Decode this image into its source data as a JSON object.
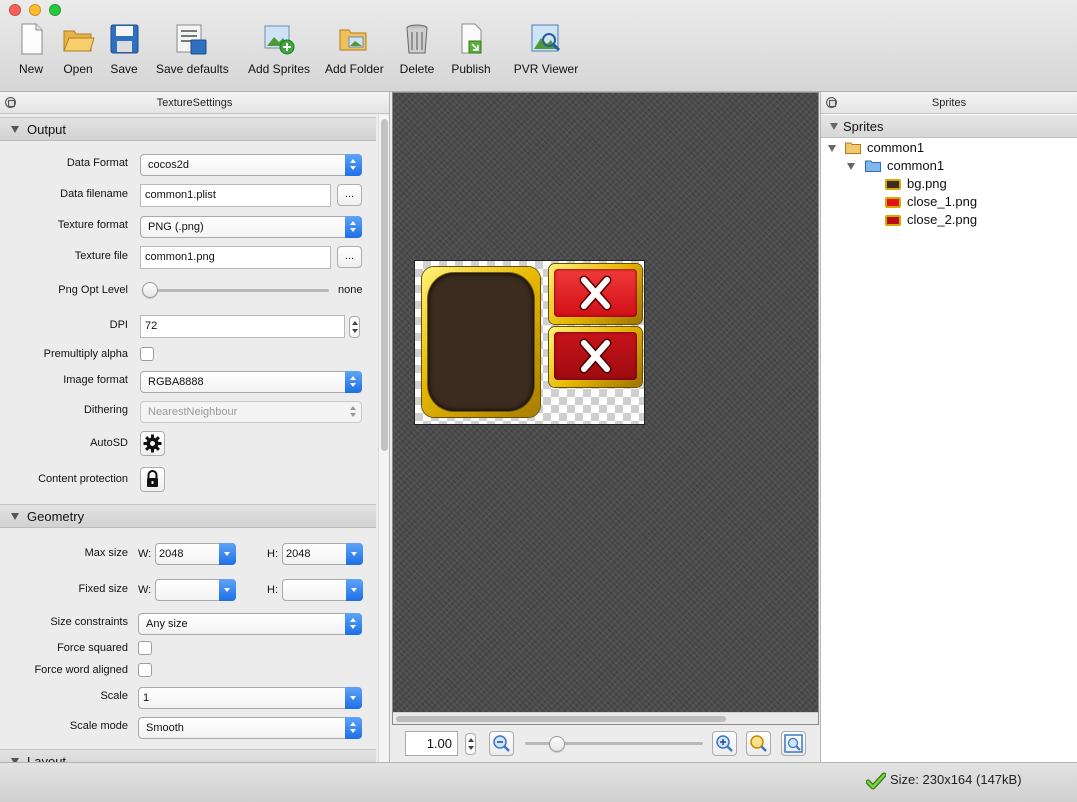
{
  "window": {
    "traffic_lights": [
      {
        "name": "close",
        "color": "#fc5f57"
      },
      {
        "name": "minimize",
        "color": "#fdbc2e"
      },
      {
        "name": "zoom",
        "color": "#28c840"
      }
    ]
  },
  "toolbar": {
    "buttons": [
      {
        "label": "New",
        "icon": "new-document-icon"
      },
      {
        "label": "Open",
        "icon": "open-folder-icon"
      },
      {
        "label": "Save",
        "icon": "save-floppy-icon"
      },
      {
        "label": "Save defaults",
        "icon": "save-defaults-icon"
      },
      {
        "label": "Add Sprites",
        "icon": "add-sprites-icon"
      },
      {
        "label": "Add Folder",
        "icon": "add-folder-icon"
      },
      {
        "label": "Delete",
        "icon": "trash-can-icon"
      },
      {
        "label": "Publish",
        "icon": "publish-icon"
      },
      {
        "label": "PVR Viewer",
        "icon": "pvr-viewer-icon"
      }
    ]
  },
  "texture_settings": {
    "panel_title": "TextureSettings",
    "output": {
      "section_title": "Output",
      "data_format": {
        "label": "Data Format",
        "value": "cocos2d"
      },
      "data_filename": {
        "label": "Data filename",
        "value": "common1.plist",
        "browse": "..."
      },
      "texture_format": {
        "label": "Texture format",
        "value": "PNG (.png)"
      },
      "texture_file": {
        "label": "Texture file",
        "value": "common1.png",
        "browse": "..."
      },
      "png_opt_level": {
        "label": "Png Opt Level",
        "value_label": "none",
        "level": 0
      },
      "dpi": {
        "label": "DPI",
        "value": "72"
      },
      "premultiply_alpha": {
        "label": "Premultiply alpha",
        "checked": false
      },
      "image_format": {
        "label": "Image format",
        "value": "RGBA8888"
      },
      "dithering": {
        "label": "Dithering",
        "value": "NearestNeighbour",
        "enabled": false
      },
      "autosd": {
        "label": "AutoSD",
        "icon": "gear-icon"
      },
      "content_protection": {
        "label": "Content protection",
        "icon": "lock-icon"
      }
    },
    "geometry": {
      "section_title": "Geometry",
      "max_size": {
        "label": "Max size",
        "w_label": "W:",
        "w_value": "2048",
        "h_label": "H:",
        "h_value": "2048"
      },
      "fixed_size": {
        "label": "Fixed size",
        "w_label": "W:",
        "w_value": "",
        "h_label": "H:",
        "h_value": ""
      },
      "size_constraints": {
        "label": "Size constraints",
        "value": "Any size"
      },
      "force_squared": {
        "label": "Force squared",
        "checked": false
      },
      "force_word_aligned": {
        "label": "Force word aligned",
        "checked": false
      },
      "scale": {
        "label": "Scale",
        "value": "1"
      },
      "scale_mode": {
        "label": "Scale mode",
        "value": "Smooth"
      }
    },
    "layout": {
      "section_title": "Layout"
    }
  },
  "canvas": {
    "zoom_value": "1.00",
    "zoom_level": 0.15,
    "sprites_preview": [
      {
        "name": "bg.png",
        "fill": "#3b2c1f",
        "frame": "#e6b800"
      },
      {
        "name": "close_1.png",
        "fill": "#e0141c",
        "frame": "#e6b800"
      },
      {
        "name": "close_2.png",
        "fill": "#b80e14",
        "frame": "#e6b800"
      }
    ]
  },
  "sprites_panel": {
    "panel_title": "Sprites",
    "header": "Sprites",
    "tree": [
      {
        "label": "common1",
        "type": "folder",
        "depth": 0,
        "expanded": true
      },
      {
        "label": "common1",
        "type": "folder",
        "depth": 1,
        "expanded": true
      },
      {
        "label": "bg.png",
        "type": "sprite",
        "depth": 2
      },
      {
        "label": "close_1.png",
        "type": "sprite",
        "depth": 2
      },
      {
        "label": "close_2.png",
        "type": "sprite",
        "depth": 2
      }
    ]
  },
  "status": {
    "size_text": "Size: 230x164 (147kB)",
    "icon": "check-mark-icon",
    "accent": "#4aa21a"
  }
}
